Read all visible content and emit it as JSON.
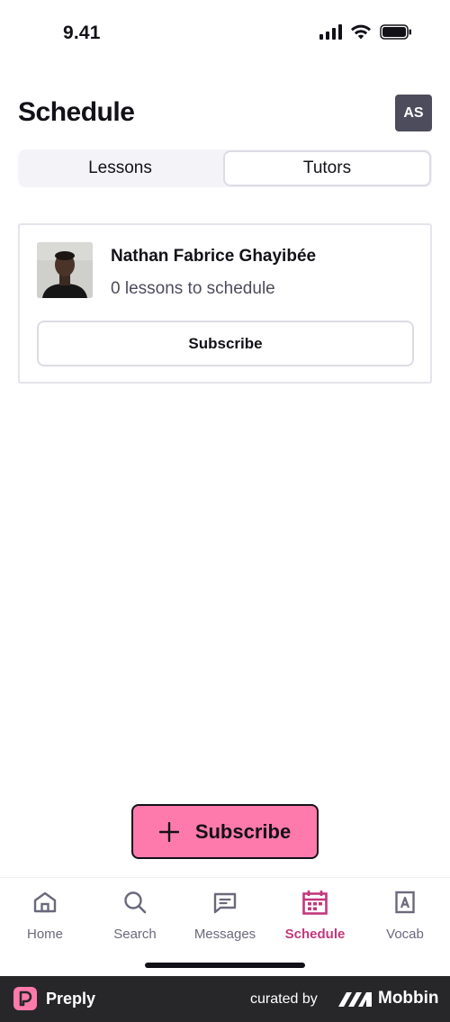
{
  "status_bar": {
    "time": "9.41"
  },
  "header": {
    "title": "Schedule",
    "avatar_initials": "AS"
  },
  "segments": [
    {
      "label": "Lessons",
      "active": false
    },
    {
      "label": "Tutors",
      "active": true
    }
  ],
  "tutor_card": {
    "name": "Nathan Fabrice Ghayibée",
    "subtitle": "0 lessons to schedule",
    "button_label": "Subscribe"
  },
  "fab": {
    "label": "Subscribe",
    "icon": "plus-icon"
  },
  "tabbar": {
    "items": [
      {
        "label": "Home",
        "icon": "home-icon"
      },
      {
        "label": "Search",
        "icon": "search-icon"
      },
      {
        "label": "Messages",
        "icon": "messages-icon"
      },
      {
        "label": "Schedule",
        "icon": "calendar-icon",
        "active": true
      },
      {
        "label": "Vocab",
        "icon": "vocab-icon"
      }
    ]
  },
  "footer": {
    "brand": "Preply",
    "curated_by": "curated by",
    "curator": "Mobbin"
  },
  "colors": {
    "accent": "#ff7aac",
    "active_tab": "#c2387c",
    "text": "#121117",
    "avatar_bg": "#4d4c5c",
    "footer_bg": "#27272a"
  }
}
